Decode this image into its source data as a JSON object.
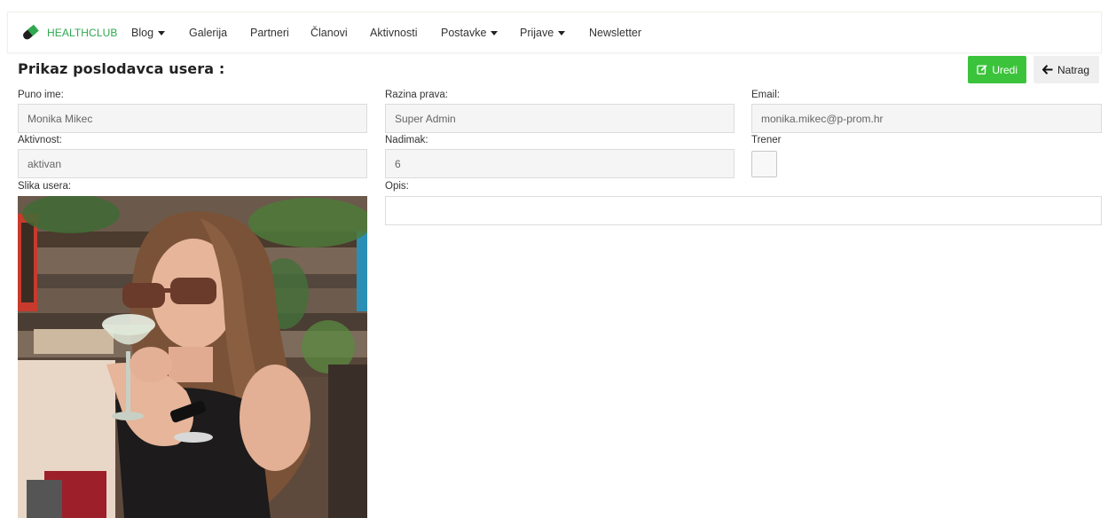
{
  "nav": {
    "brand": "HEALTHCLUB",
    "items": [
      {
        "label": "Blog",
        "dropdown": true
      },
      {
        "label": "Galerija",
        "dropdown": false
      },
      {
        "label": "Partneri",
        "dropdown": false
      },
      {
        "label": "Članovi",
        "dropdown": false
      },
      {
        "label": "Aktivnosti",
        "dropdown": false
      },
      {
        "label": "Postavke",
        "dropdown": true
      },
      {
        "label": "Prijave",
        "dropdown": true
      },
      {
        "label": "Newsletter",
        "dropdown": false
      }
    ]
  },
  "page": {
    "title": "Prikaz poslodavca usera :",
    "edit_label": "Uredi",
    "back_label": "Natrag"
  },
  "form": {
    "full_name": {
      "label": "Puno ime:",
      "value": "Monika Mikec"
    },
    "role": {
      "label": "Razina prava:",
      "value": "Super Admin"
    },
    "email": {
      "label": "Email:",
      "value": "monika.mikec@p-prom.hr"
    },
    "activity": {
      "label": "Aktivnost:",
      "value": "aktivan"
    },
    "nickname": {
      "label": "Nadimak:",
      "value": "6"
    },
    "trainer": {
      "label": "Trener",
      "checked": false
    },
    "photo": {
      "label": "Slika usera:"
    },
    "description": {
      "label": "Opis:",
      "value": ""
    }
  },
  "colors": {
    "brand": "#2fa84f",
    "edit_button": "#3bc43b",
    "back_button": "#efefef"
  },
  "icons": {
    "logo": "healthclub-pill-logo-icon",
    "edit": "edit-icon",
    "back": "arrow-left-icon",
    "dropdown": "caret-down-icon"
  }
}
